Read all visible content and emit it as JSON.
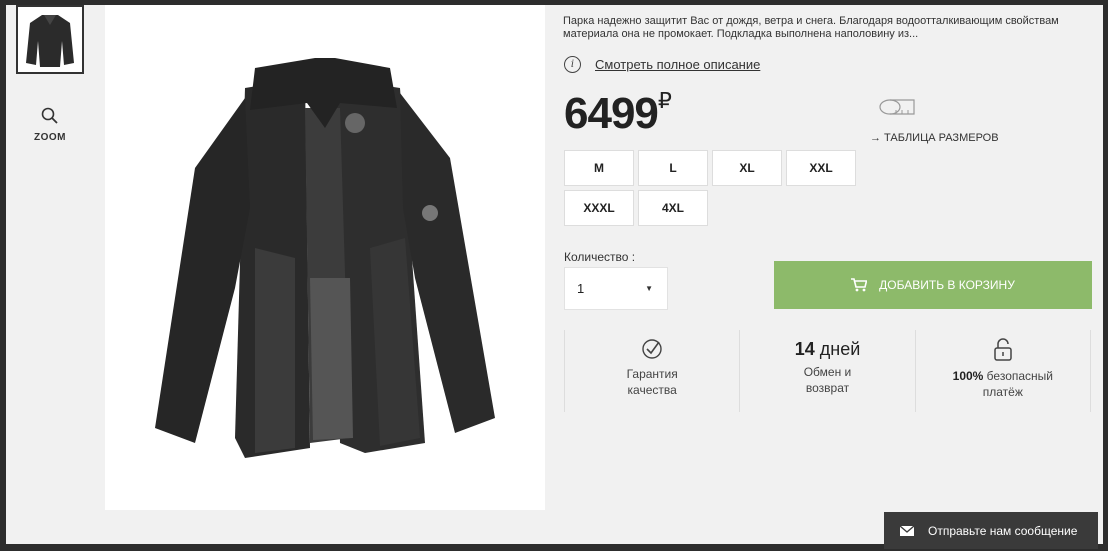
{
  "zoom": {
    "label": "ZOOM",
    "icon": "search-icon"
  },
  "product": {
    "description": "Парка надежно защитит Вас от дождя, ветра и снега. Благодаря водоотталкивающим свойствам материала она не промокает. Подкладка выполнена наполовину из...",
    "full_description_link": "Смотреть полное описание",
    "price": "6499",
    "currency": "₽"
  },
  "size_table": {
    "label": "→  ТАБЛИЦА РАЗМЕРОВ",
    "icon": "measuring-tape-icon"
  },
  "sizes": [
    "M",
    "L",
    "XL",
    "XXL",
    "XXXL",
    "4XL"
  ],
  "quantity": {
    "label": "Количество :",
    "value": "1"
  },
  "cart_button": {
    "label": "ДОБАВИТЬ В КОРЗИНУ",
    "icon": "cart-icon"
  },
  "features": [
    {
      "icon": "check-badge-icon",
      "line1": "Гарантия",
      "line2": "качества"
    },
    {
      "big_num": "14",
      "big_unit": "дней",
      "line1": "Обмен и",
      "line2": "возврат"
    },
    {
      "icon": "lock-icon",
      "bold": "100%",
      "rest": " безопасный",
      "line2": "платёж"
    }
  ],
  "message_button": {
    "label": "Отправьте нам сообщение",
    "icon": "envelope-icon"
  },
  "colors": {
    "accent_green": "#8dba6a",
    "dark_bar": "#3a3a3a"
  }
}
